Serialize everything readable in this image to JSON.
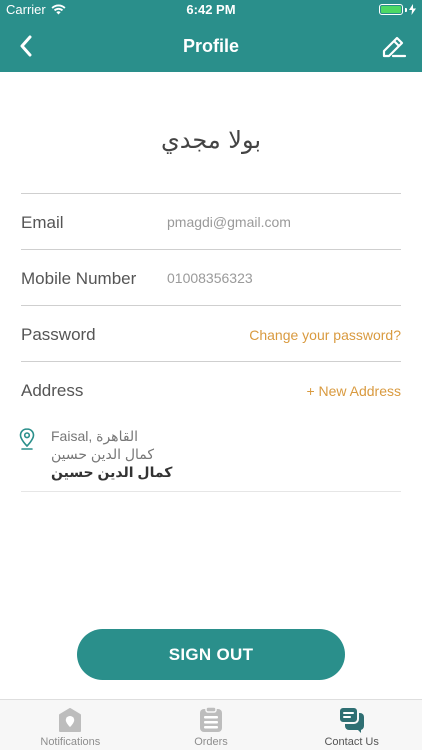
{
  "status_bar": {
    "carrier": "Carrier",
    "time": "6:42 PM",
    "battery_level": 1.0,
    "battery_color": "#4cd964"
  },
  "header": {
    "title": "Profile",
    "back_icon": "chevron-left-icon",
    "edit_icon": "pencil-icon",
    "background": "#2a8f8b"
  },
  "profile": {
    "name": "بولا مجدي"
  },
  "fields": {
    "email_label": "Email",
    "email_value": "pmagdi@gmail.com",
    "mobile_label": "Mobile Number",
    "mobile_value": "01008356323",
    "password_label": "Password",
    "password_link": "Change your password?",
    "address_label": "Address",
    "address_link": "+ New Address"
  },
  "addresses": [
    {
      "icon": "map-pin-icon",
      "line1": "Faisal, القاهرة",
      "line2": "كمال الدين حسين",
      "line3": "كمال الدين حسين"
    }
  ],
  "actions": {
    "sign_out": "SIGN OUT"
  },
  "tabs": [
    {
      "label": "Notifications",
      "icon": "notification-badge-icon",
      "active": false
    },
    {
      "label": "Orders",
      "icon": "orders-list-icon",
      "active": false
    },
    {
      "label": "Contact Us",
      "icon": "chat-bubbles-icon",
      "active": true
    }
  ],
  "colors": {
    "accent": "#2a8f8b",
    "link": "#d99a3f"
  }
}
